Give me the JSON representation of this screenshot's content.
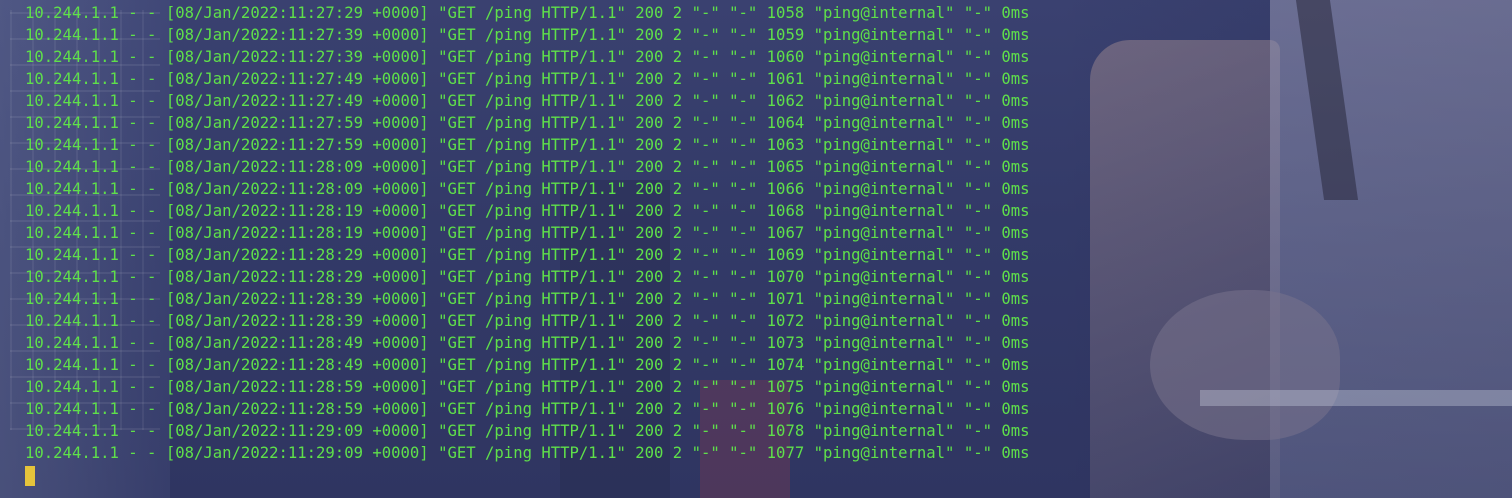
{
  "terminal": {
    "lines": [
      "10.244.1.1 - - [08/Jan/2022:11:27:29 +0000] \"GET /ping HTTP/1.1\" 200 2 \"-\" \"-\" 1058 \"ping@internal\" \"-\" 0ms",
      "10.244.1.1 - - [08/Jan/2022:11:27:39 +0000] \"GET /ping HTTP/1.1\" 200 2 \"-\" \"-\" 1059 \"ping@internal\" \"-\" 0ms",
      "10.244.1.1 - - [08/Jan/2022:11:27:39 +0000] \"GET /ping HTTP/1.1\" 200 2 \"-\" \"-\" 1060 \"ping@internal\" \"-\" 0ms",
      "10.244.1.1 - - [08/Jan/2022:11:27:49 +0000] \"GET /ping HTTP/1.1\" 200 2 \"-\" \"-\" 1061 \"ping@internal\" \"-\" 0ms",
      "10.244.1.1 - - [08/Jan/2022:11:27:49 +0000] \"GET /ping HTTP/1.1\" 200 2 \"-\" \"-\" 1062 \"ping@internal\" \"-\" 0ms",
      "10.244.1.1 - - [08/Jan/2022:11:27:59 +0000] \"GET /ping HTTP/1.1\" 200 2 \"-\" \"-\" 1064 \"ping@internal\" \"-\" 0ms",
      "10.244.1.1 - - [08/Jan/2022:11:27:59 +0000] \"GET /ping HTTP/1.1\" 200 2 \"-\" \"-\" 1063 \"ping@internal\" \"-\" 0ms",
      "10.244.1.1 - - [08/Jan/2022:11:28:09 +0000] \"GET /ping HTTP/1.1\" 200 2 \"-\" \"-\" 1065 \"ping@internal\" \"-\" 0ms",
      "10.244.1.1 - - [08/Jan/2022:11:28:09 +0000] \"GET /ping HTTP/1.1\" 200 2 \"-\" \"-\" 1066 \"ping@internal\" \"-\" 0ms",
      "10.244.1.1 - - [08/Jan/2022:11:28:19 +0000] \"GET /ping HTTP/1.1\" 200 2 \"-\" \"-\" 1068 \"ping@internal\" \"-\" 0ms",
      "10.244.1.1 - - [08/Jan/2022:11:28:19 +0000] \"GET /ping HTTP/1.1\" 200 2 \"-\" \"-\" 1067 \"ping@internal\" \"-\" 0ms",
      "10.244.1.1 - - [08/Jan/2022:11:28:29 +0000] \"GET /ping HTTP/1.1\" 200 2 \"-\" \"-\" 1069 \"ping@internal\" \"-\" 0ms",
      "10.244.1.1 - - [08/Jan/2022:11:28:29 +0000] \"GET /ping HTTP/1.1\" 200 2 \"-\" \"-\" 1070 \"ping@internal\" \"-\" 0ms",
      "10.244.1.1 - - [08/Jan/2022:11:28:39 +0000] \"GET /ping HTTP/1.1\" 200 2 \"-\" \"-\" 1071 \"ping@internal\" \"-\" 0ms",
      "10.244.1.1 - - [08/Jan/2022:11:28:39 +0000] \"GET /ping HTTP/1.1\" 200 2 \"-\" \"-\" 1072 \"ping@internal\" \"-\" 0ms",
      "10.244.1.1 - - [08/Jan/2022:11:28:49 +0000] \"GET /ping HTTP/1.1\" 200 2 \"-\" \"-\" 1073 \"ping@internal\" \"-\" 0ms",
      "10.244.1.1 - - [08/Jan/2022:11:28:49 +0000] \"GET /ping HTTP/1.1\" 200 2 \"-\" \"-\" 1074 \"ping@internal\" \"-\" 0ms",
      "10.244.1.1 - - [08/Jan/2022:11:28:59 +0000] \"GET /ping HTTP/1.1\" 200 2 \"-\" \"-\" 1075 \"ping@internal\" \"-\" 0ms",
      "10.244.1.1 - - [08/Jan/2022:11:28:59 +0000] \"GET /ping HTTP/1.1\" 200 2 \"-\" \"-\" 1076 \"ping@internal\" \"-\" 0ms",
      "10.244.1.1 - - [08/Jan/2022:11:29:09 +0000] \"GET /ping HTTP/1.1\" 200 2 \"-\" \"-\" 1078 \"ping@internal\" \"-\" 0ms",
      "10.244.1.1 - - [08/Jan/2022:11:29:09 +0000] \"GET /ping HTTP/1.1\" 200 2 \"-\" \"-\" 1077 \"ping@internal\" \"-\" 0ms"
    ],
    "cursor_color": "#e5c43b",
    "text_color": "#5fe04a",
    "background_color": "#2f3561"
  }
}
